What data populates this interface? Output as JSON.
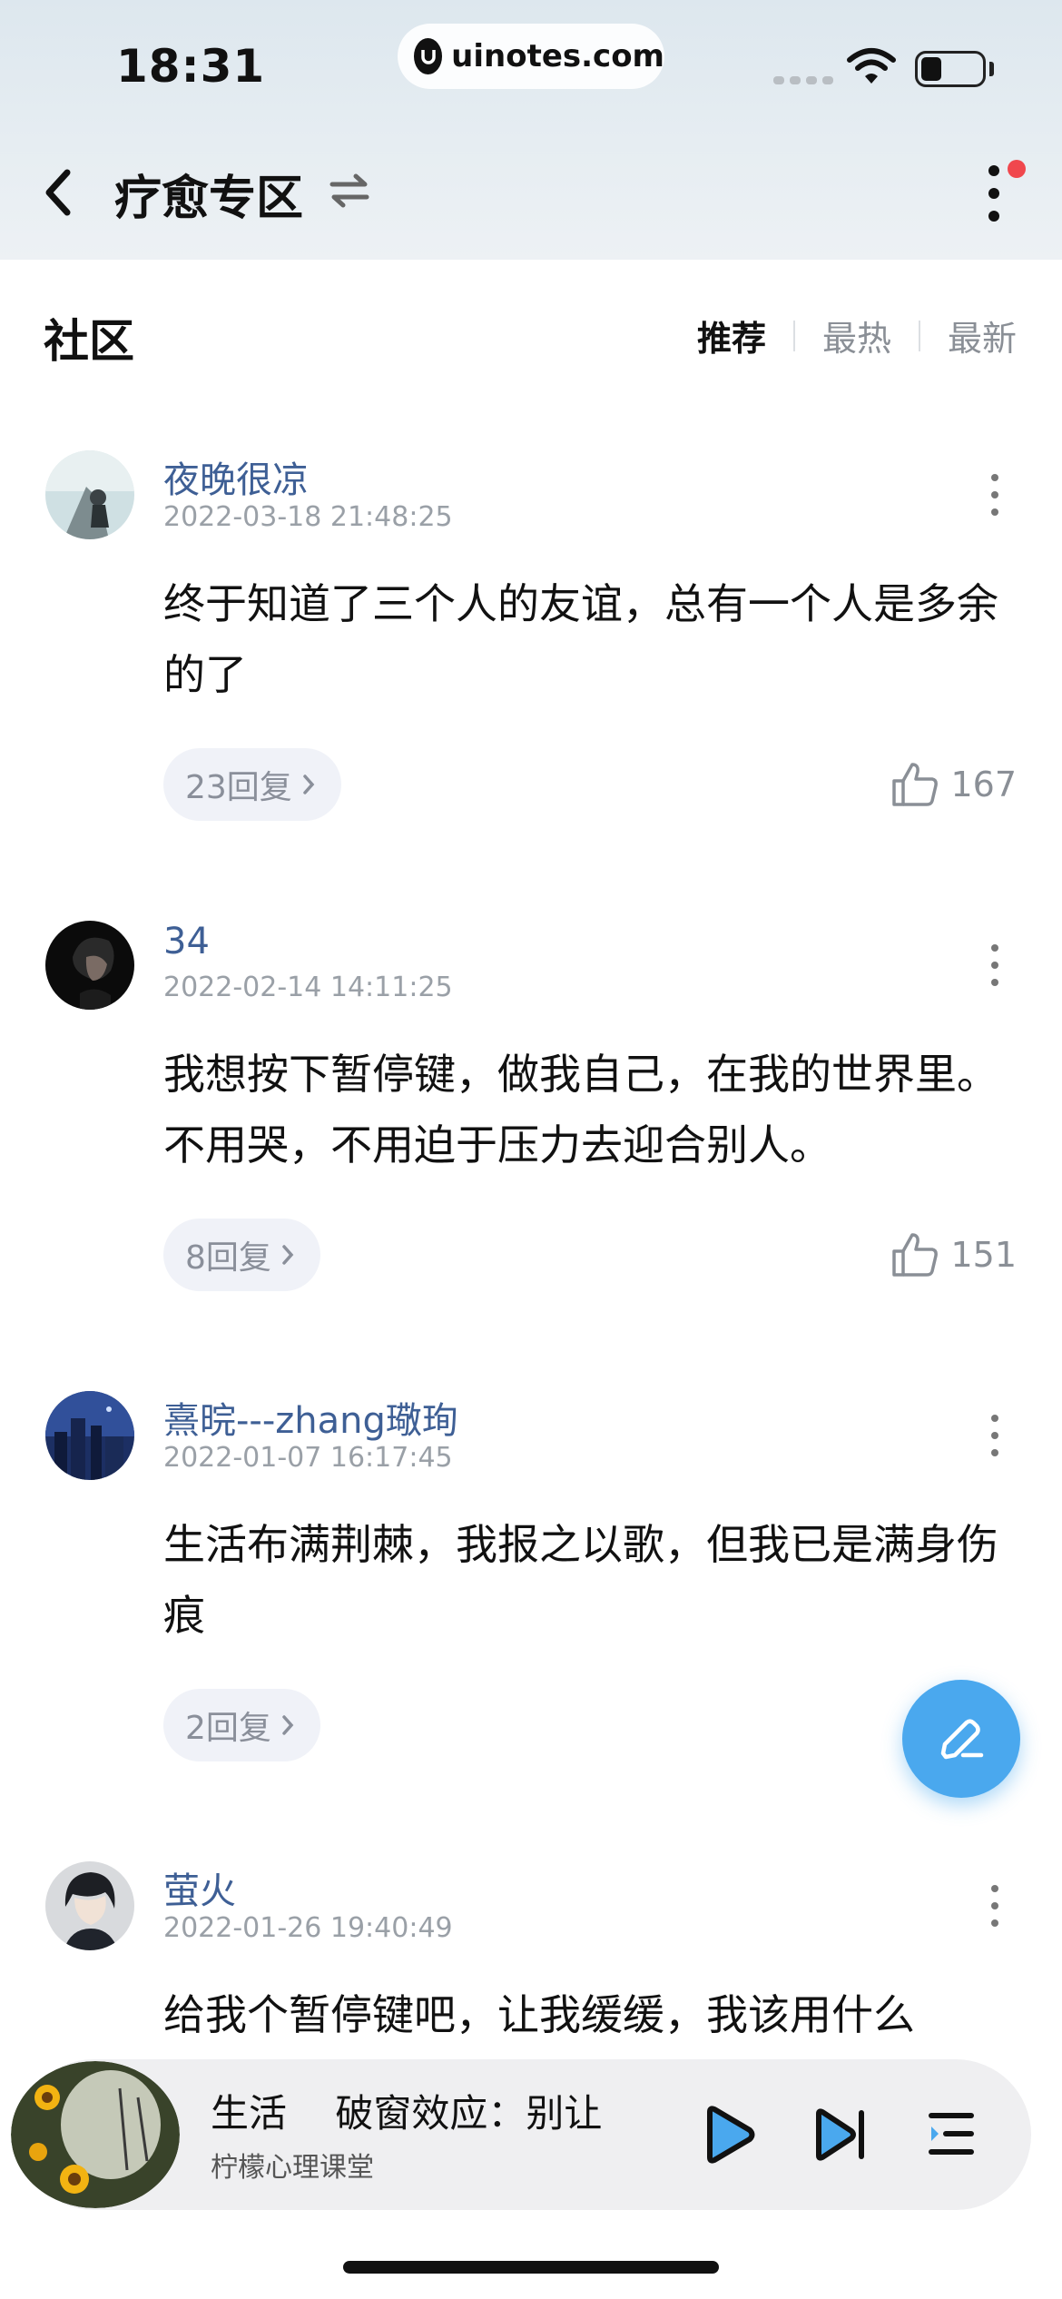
{
  "status_bar": {
    "time": "18:31",
    "url": "uinotes.com"
  },
  "header": {
    "back_icon": "chevron-left-icon",
    "title": "疗愈专区",
    "swap_icon": "swap-arrows-icon",
    "more_icon": "vertical-dots-icon"
  },
  "community": {
    "title": "社区",
    "sort_tabs": [
      {
        "label": "推荐",
        "active": true
      },
      {
        "label": "最热",
        "active": false
      },
      {
        "label": "最新",
        "active": false
      }
    ]
  },
  "posts": [
    {
      "username": "夜晚很凉",
      "timestamp": "2022-03-18 21:48:25",
      "content": "终于知道了三个人的友谊，总有一个人是多余的了",
      "replies": "23回复",
      "likes": "167"
    },
    {
      "username": "34",
      "timestamp": "2022-02-14 14:11:25",
      "content": "我想按下暂停键，做我自己，在我的世界里。不用哭，不用迫于压力去迎合别人。",
      "replies": "8回复",
      "likes": "151"
    },
    {
      "username": "熹晥---zhang璥珣",
      "timestamp": "2022-01-07 16:17:45",
      "content": "生活布满荆棘，我报之以歌，但我已是满身伤痕",
      "replies": "2回复",
      "likes": ""
    },
    {
      "username": "萤火",
      "timestamp": "2022-01-26 19:40:49",
      "content": "给我个暂停键吧，让我缓缓，我该用什么"
    }
  ],
  "fab": {
    "icon": "edit-pencil-icon"
  },
  "player": {
    "title": "生活    破窗效应：别让",
    "artist": "柠檬心理课堂",
    "play_icon": "play-icon",
    "next_icon": "skip-next-icon",
    "list_icon": "playlist-icon"
  },
  "colors": {
    "accent": "#4aa8ee",
    "username": "#3e5f95",
    "notification_dot": "#f0474d"
  }
}
